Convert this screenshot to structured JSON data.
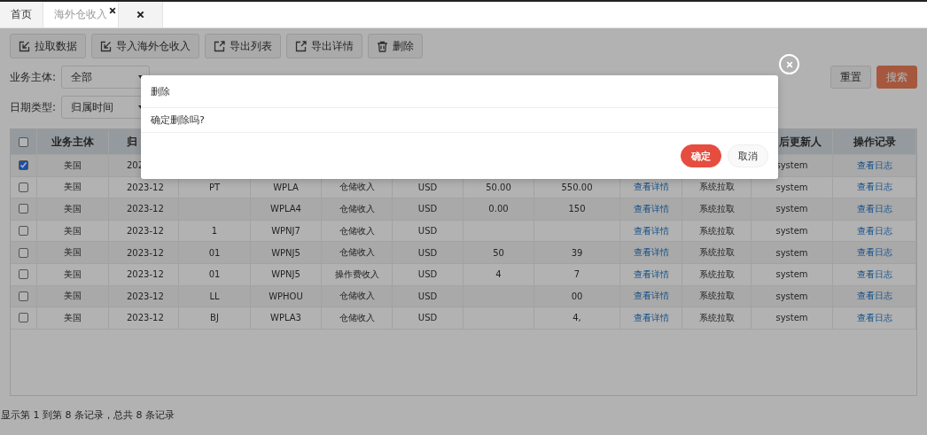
{
  "tabs": [
    {
      "label": "首页",
      "selected": false,
      "close": false
    },
    {
      "label": "海外仓收入",
      "selected": true,
      "close": true
    },
    {
      "close": true,
      "selected": false
    }
  ],
  "toolbar": [
    {
      "label": "拉取数据",
      "kind": "import"
    },
    {
      "label": "导入海外仓收入",
      "kind": "import"
    },
    {
      "label": "导出列表",
      "kind": "export"
    },
    {
      "label": "导出详情",
      "kind": "export"
    },
    {
      "label": "删除",
      "kind": "trash"
    }
  ],
  "filters": [
    [
      {
        "label": "业务主体:",
        "value": "全部"
      }
    ],
    [
      {
        "label": "日期类型:",
        "value": "归属时间"
      }
    ]
  ],
  "actions": {
    "reset": "重置",
    "search": "搜索"
  },
  "table": {
    "all_checked": false,
    "columns": [
      "业务主体",
      "归",
      "",
      "",
      "",
      "",
      "",
      "",
      "",
      "",
      "后更新人",
      "操作记录"
    ],
    "rows": [
      {
        "checked": true,
        "cells": [
          "美国",
          "202",
          "",
          "",
          "",
          "",
          "",
          "",
          "",
          "",
          "system",
          "查看日志"
        ]
      },
      {
        "checked": false,
        "cells": [
          "美国",
          "2023-12",
          "PT",
          "WPLA",
          "仓储收入",
          "USD",
          "50.00",
          "550.00",
          "查看详情",
          "系统拉取",
          "system",
          "查看日志"
        ]
      },
      {
        "checked": false,
        "cells": [
          "美国",
          "2023-12",
          "",
          "WPLA4",
          "仓储收入",
          "USD",
          "0.00",
          "150",
          "查看详情",
          "系统拉取",
          "system",
          "查看日志"
        ]
      },
      {
        "checked": false,
        "cells": [
          "美国",
          "2023-12",
          "1",
          "WPNJ7",
          "仓储收入",
          "USD",
          "",
          "",
          "查看详情",
          "系统拉取",
          "system",
          "查看日志"
        ]
      },
      {
        "checked": false,
        "cells": [
          "美国",
          "2023-12",
          "01",
          "WPNJ5",
          "仓储收入",
          "USD",
          "50",
          "39",
          "查看详情",
          "系统拉取",
          "system",
          "查看日志"
        ]
      },
      {
        "checked": false,
        "cells": [
          "美国",
          "2023-12",
          "01",
          "WPNJ5",
          "操作费收入",
          "USD",
          "4",
          "7",
          "查看详情",
          "系统拉取",
          "system",
          "查看日志"
        ]
      },
      {
        "checked": false,
        "cells": [
          "美国",
          "2023-12",
          "LL",
          "WPHOU",
          "仓储收入",
          "USD",
          "",
          "00",
          "查看详情",
          "系统拉取",
          "system",
          "查看日志"
        ]
      },
      {
        "checked": false,
        "cells": [
          "美国",
          "2023-12",
          "BJ",
          "WPLA3",
          "仓储收入",
          "USD",
          "",
          "4,",
          "查看详情",
          "系统拉取",
          "system",
          "查看日志"
        ]
      }
    ]
  },
  "footer": "显示第 1 到第 8 条记录，总共 8 条记录",
  "dialog": {
    "title": "删除",
    "message": "确定删除吗?",
    "confirm": "确定",
    "cancel": "取消"
  }
}
